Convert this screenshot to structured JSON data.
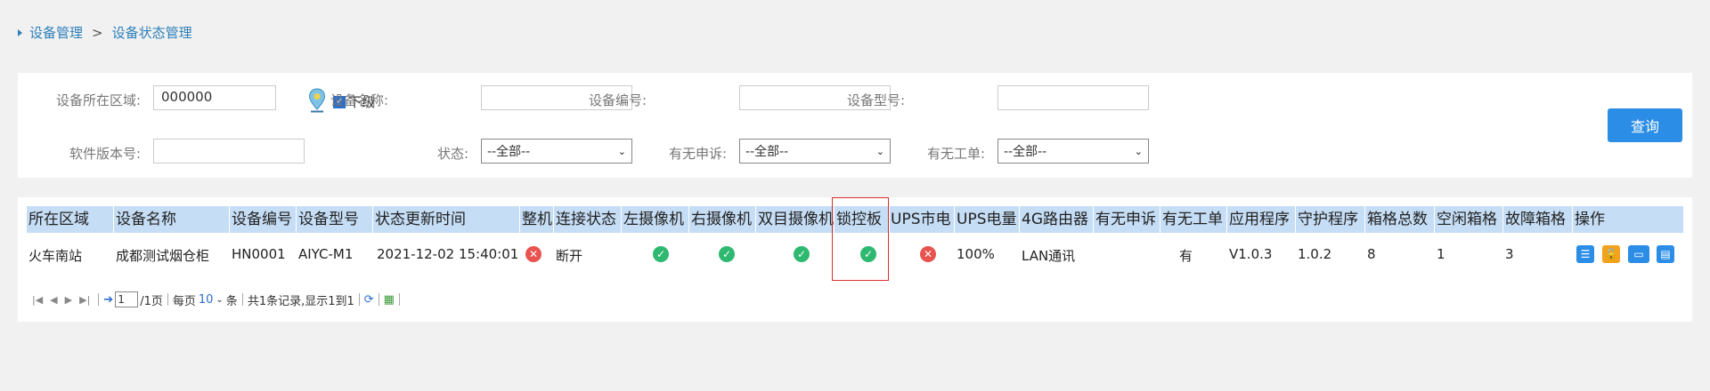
{
  "breadcrumb": {
    "parent": "设备管理",
    "separator": ">",
    "current": "设备状态管理"
  },
  "search": {
    "region_label": "设备所在区域:",
    "region_value": "000000",
    "sub_level_label": "下级",
    "device_name_label": "设备名称:",
    "device_name_value": "",
    "device_no_label": "设备编号:",
    "device_no_value": "",
    "device_model_label": "设备型号:",
    "device_model_value": "",
    "software_version_label": "软件版本号:",
    "software_version_value": "",
    "status_label": "状态:",
    "status_value": "--全部--",
    "complaint_label": "有无申诉:",
    "complaint_value": "--全部--",
    "workorder_label": "有无工单:",
    "workorder_value": "--全部--",
    "query_button": "查询"
  },
  "table": {
    "columns": [
      "所在区域",
      "设备名称",
      "设备编号",
      "设备型号",
      "状态更新时间",
      "整机",
      "连接状态",
      "左摄像机",
      "右摄像机",
      "双目摄像机",
      "锁控板",
      "UPS市电",
      "UPS电量",
      "4G路由器",
      "有无申诉",
      "有无工单",
      "应用程序",
      "守护程序",
      "箱格总数",
      "空闲箱格",
      "故障箱格",
      "操作"
    ],
    "rows": [
      {
        "region": "火车南站",
        "device_name": "成都测试烟仓柜",
        "device_no": "HN0001",
        "model": "AIYC-M1",
        "updated": "2021-12-02 15:40:01",
        "whole_machine": "error",
        "connection": "断开",
        "left_camera": "ok",
        "right_camera": "ok",
        "binocular_camera": "ok",
        "lock_board": "ok",
        "ups_mains": "error",
        "ups_power": "100%",
        "router_4g": "LAN通讯",
        "complaint": "",
        "workorder": "有",
        "app_version": "V1.0.3",
        "daemon_version": "1.0.2",
        "total_cells": "8",
        "free_cells": "1",
        "fault_cells": "3"
      }
    ]
  },
  "pager": {
    "current_page": "1",
    "total_pages": "/1页",
    "per_page_label": "每页",
    "per_page_value": "10",
    "per_page_unit": "条",
    "summary": "共1条记录,显示1到1"
  },
  "colors": {
    "accent": "#2b8de6",
    "header_bg": "#c5ddf5",
    "ok": "#2fb870",
    "error": "#e9534f",
    "highlight": "#d9302c"
  }
}
